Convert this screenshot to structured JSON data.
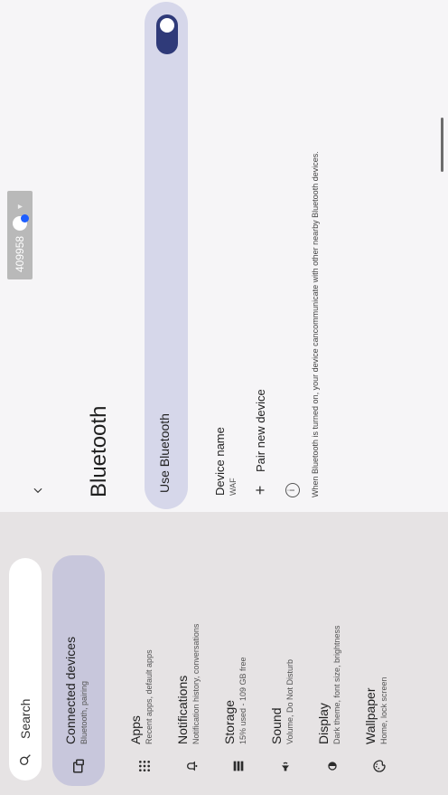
{
  "left_pane": {
    "search_placeholder": "Search",
    "items": [
      {
        "title": "Connected devices",
        "subtitle": "Bluetooth, pairing",
        "icon": "devices-icon",
        "selected": true
      },
      {
        "title": "Apps",
        "subtitle": "Recent apps, default apps",
        "icon": "apps-grid-icon"
      },
      {
        "title": "Notifications",
        "subtitle": "Notification history, conversations",
        "icon": "bell-icon"
      },
      {
        "title": "Storage",
        "subtitle": "15% used - 109 GB free",
        "icon": "storage-icon"
      },
      {
        "title": "Sound",
        "subtitle": "Volume, Do Not Disturb",
        "icon": "volume-icon"
      },
      {
        "title": "Display",
        "subtitle": "Dark theme, font size, brightness",
        "icon": "display-icon"
      },
      {
        "title": "Wallpaper",
        "subtitle": "Home, lock screen",
        "icon": "palette-icon"
      }
    ]
  },
  "right_pane": {
    "title": "Bluetooth",
    "use_bluetooth_label": "Use Bluetooth",
    "use_bluetooth_on": true,
    "device_name_label": "Device name",
    "device_name_value": "WAF",
    "pair_new_device_label": "Pair new device",
    "info_text": "When Bluetooth is turned on, your device cancommunicate with other nearby Bluetooth devices."
  },
  "status_chip": {
    "number": "409958"
  },
  "colors": {
    "selected_bg": "#c8c7dc",
    "toggle_on": "#2f3a79",
    "row_bg": "#d6d7ea"
  }
}
